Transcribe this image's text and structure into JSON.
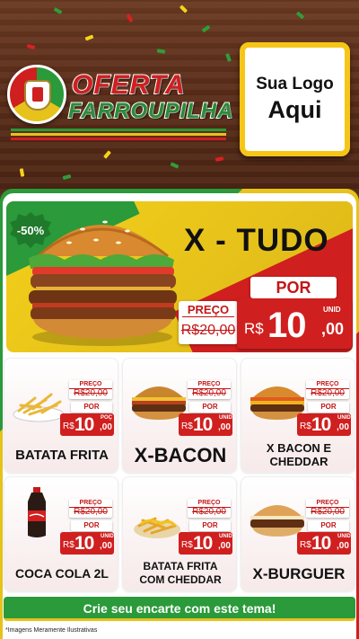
{
  "header": {
    "title_line1": "OFERTA",
    "title_line2": "FARROUPILHA",
    "logo_box_line1": "Sua Logo",
    "logo_box_line2": "Aqui"
  },
  "colors": {
    "green": "#2a9a3a",
    "yellow": "#e6c21a",
    "red": "#d01f1f",
    "wood": "#5a2f1c"
  },
  "hero": {
    "discount": "-50%",
    "title": "X - TUDO",
    "preco_label": "PREÇO",
    "old_price": "R$20,00",
    "por_label": "POR",
    "currency": "R$",
    "price_int": "10",
    "price_dec": ",00",
    "unit": "UNID"
  },
  "products": [
    {
      "name": "BATATA FRITA",
      "preco_label": "PREÇO",
      "old": "R$20,00",
      "por_label": "POR",
      "currency": "R$",
      "int": "10",
      "dec": ",00",
      "unit": "POÇ",
      "icon": "fries-icon"
    },
    {
      "name": "X-BACON",
      "preco_label": "PREÇO",
      "old": "R$20,00",
      "por_label": "POR",
      "currency": "R$",
      "int": "10",
      "dec": ",00",
      "unit": "UNID",
      "icon": "burger-icon"
    },
    {
      "name": "X BACON E CHEDDAR",
      "preco_label": "PREÇO",
      "old": "R$20,00",
      "por_label": "POR",
      "currency": "R$",
      "int": "10",
      "dec": ",00",
      "unit": "UNID",
      "icon": "burger-icon"
    },
    {
      "name": "COCA COLA 2L",
      "preco_label": "PREÇO",
      "old": "R$20,00",
      "por_label": "POR",
      "currency": "R$",
      "int": "10",
      "dec": ",00",
      "unit": "UNID",
      "icon": "soda-bottle-icon"
    },
    {
      "name": "BATATA FRITA COM CHEDDAR",
      "preco_label": "PREÇO",
      "old": "R$20,00",
      "por_label": "POR",
      "currency": "R$",
      "int": "10",
      "dec": ",00",
      "unit": "UNID",
      "icon": "fries-cheddar-icon"
    },
    {
      "name": "X-BURGUER",
      "preco_label": "PREÇO",
      "old": "R$20,00",
      "por_label": "POR",
      "currency": "R$",
      "int": "10",
      "dec": ",00",
      "unit": "UNID",
      "icon": "burger-icon"
    }
  ],
  "cta": "Crie seu encarte com este tema!",
  "footnote": "*Imagens Meramente Ilustrativas"
}
